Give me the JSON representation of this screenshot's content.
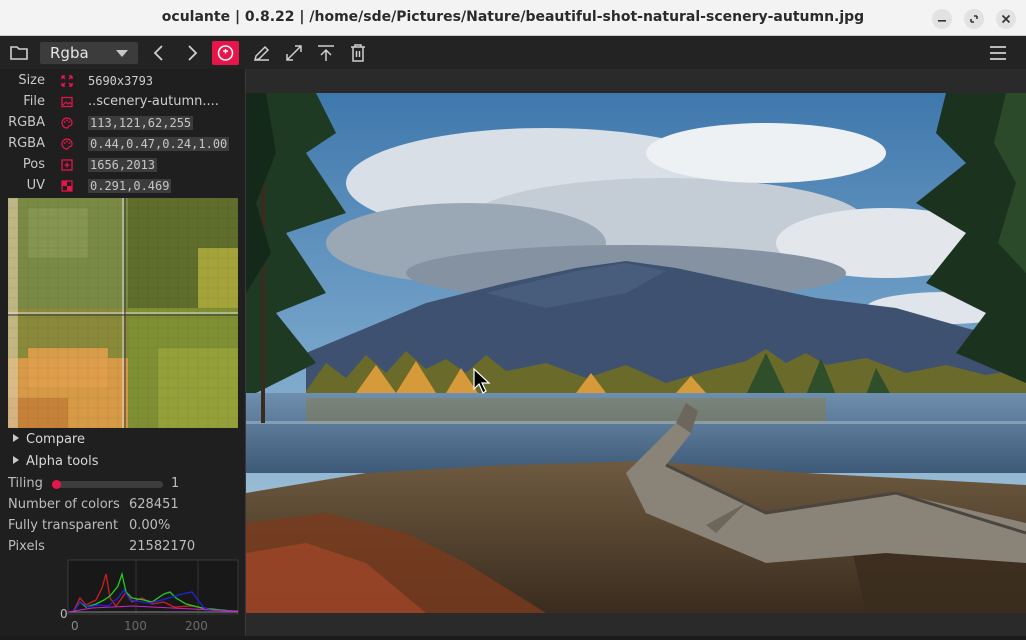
{
  "window": {
    "title": "oculante | 0.8.22 | /home/sde/Pictures/Nature/beautiful-shot-natural-scenery-autumn.jpg"
  },
  "toolbar": {
    "channel": "Rgba",
    "icons": [
      "folder-icon",
      "chevron-down-icon",
      "previous-icon",
      "next-icon",
      "info-icon",
      "edit-icon",
      "fullscreen-icon",
      "always-on-top-icon",
      "delete-icon",
      "menu-icon"
    ],
    "accent_color": "#e8154a"
  },
  "info": {
    "size_label": "Size",
    "size_value": "5690x3793",
    "file_label": "File",
    "file_value": "..scenery-autumn....",
    "rgba_label": "RGBA",
    "rgba_value": "113,121,62,255",
    "rgbaf_label": "RGBA",
    "rgbaf_value": "0.44,0.47,0.24,1.00",
    "pos_label": "Pos",
    "pos_value": "1656,2013",
    "uv_label": "UV",
    "uv_value": "0.291,0.469"
  },
  "sections": {
    "compare": "Compare",
    "alpha_tools": "Alpha tools"
  },
  "tiling": {
    "label": "Tiling",
    "value": "1"
  },
  "stats": {
    "colors_label": "Number of colors",
    "colors_value": "628451",
    "transparent_label": "Fully transparent",
    "transparent_value": "0.00%",
    "pixels_label": "Pixels",
    "pixels_value": "21582170"
  },
  "histogram": {
    "y_tick": "0",
    "x_ticks": [
      "0",
      "100",
      "200"
    ]
  }
}
